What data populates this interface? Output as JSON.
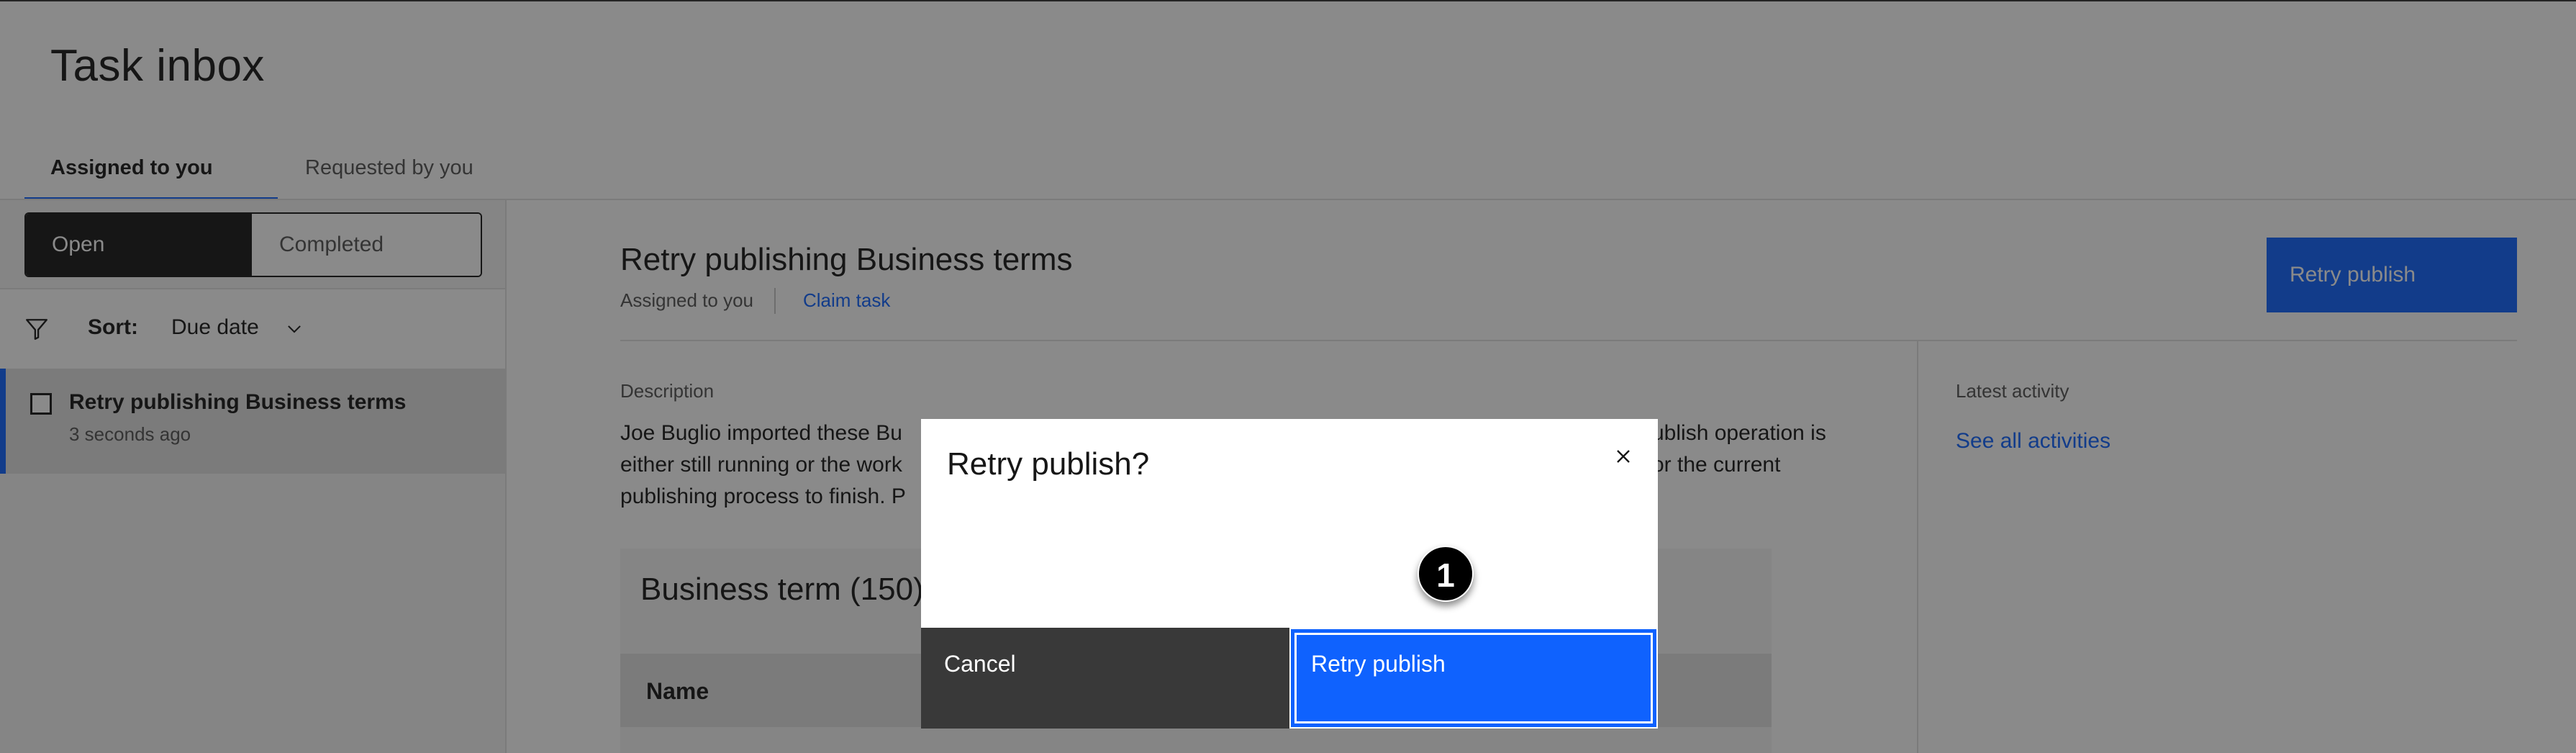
{
  "page": {
    "title": "Task inbox"
  },
  "tabs": [
    {
      "label": "Assigned to you",
      "selected": true
    },
    {
      "label": "Requested by you",
      "selected": false
    }
  ],
  "filter": {
    "open_label": "Open",
    "completed_label": "Completed"
  },
  "sort": {
    "label": "Sort:",
    "value": "Due date"
  },
  "task_list": [
    {
      "title": "Retry publishing Business terms",
      "time": "3 seconds ago"
    }
  ],
  "detail": {
    "title": "Retry publishing Business terms",
    "assigned": "Assigned to you",
    "claim": "Claim task",
    "retry_button": "Retry publish",
    "description_label": "Description",
    "description_visible": [
      "Joe Buglio imported these Bu",
      "ublish operation is",
      "either still running or the work",
      "or the current",
      "publishing process to finish. P"
    ],
    "latest_activity_label": "Latest activity",
    "see_all": "See all activities",
    "table_title": "Business term (150)",
    "table_column": "Name"
  },
  "modal": {
    "title": "Retry publish?",
    "cancel_label": "Cancel",
    "confirm_label": "Retry publish",
    "step_marker": "1"
  },
  "colors": {
    "accent": "#0f62fe",
    "dark": "#161616",
    "overlay": "rgba(22,22,22,0.5)"
  },
  "icons": [
    "filter-icon",
    "chevron-down-icon",
    "close-icon",
    "checkbox"
  ]
}
